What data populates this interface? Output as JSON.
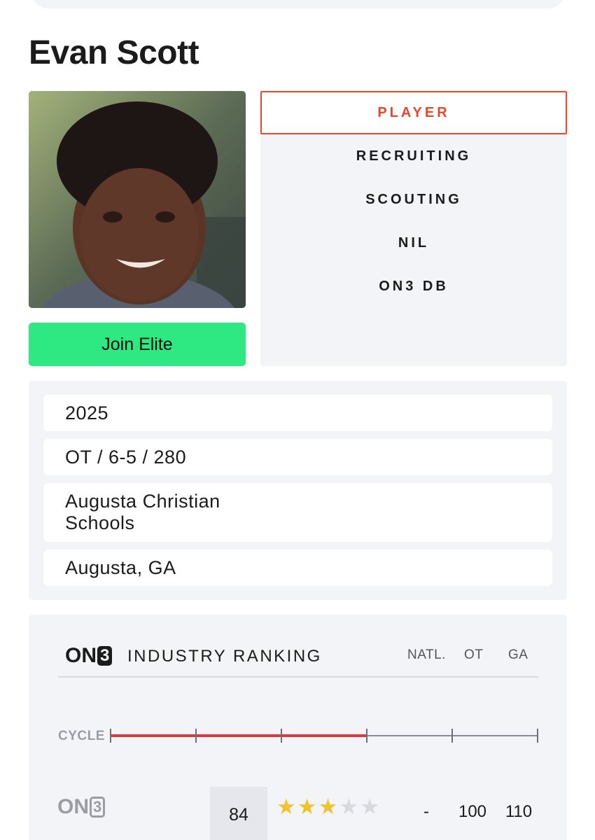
{
  "player": {
    "name": "Evan Scott",
    "join_label": "Join Elite"
  },
  "nav": {
    "items": [
      {
        "label": "PLAYER",
        "active": true
      },
      {
        "label": "RECRUITING",
        "active": false
      },
      {
        "label": "SCOUTING",
        "active": false
      },
      {
        "label": "NIL",
        "active": false
      },
      {
        "label": "ON3 DB",
        "active": false
      }
    ]
  },
  "info": {
    "class_year": "2025",
    "position_size": "OT / 6-5 / 280",
    "school_line1": "Augusta Christian",
    "school_line2": "Schools",
    "hometown": "Augusta, GA"
  },
  "ranking": {
    "brand_on": "ON",
    "brand_three": "3",
    "title": "INDUSTRY RANKING",
    "columns": [
      "NATL.",
      "OT",
      "GA"
    ],
    "cycle_label": "CYCLE",
    "cycle_progress": 0.6,
    "row": {
      "rating": "84",
      "stars": 3,
      "stars_max": 5,
      "natl": "-",
      "position_rank": "100",
      "state_rank": "110"
    }
  },
  "colors": {
    "accent_red": "#e8472e",
    "join_green": "#2ee882",
    "star_gold": "#f2c12e",
    "cycle_red": "#d93c3c"
  }
}
